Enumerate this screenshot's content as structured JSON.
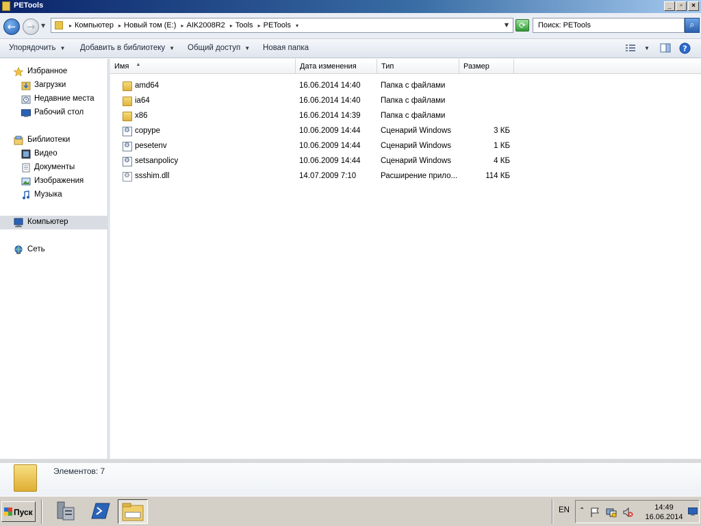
{
  "window": {
    "title": "PETools",
    "min_glyph": "_",
    "max_glyph": "▫",
    "close_glyph": "×"
  },
  "address": {
    "back_glyph": "←",
    "forward_glyph": "→",
    "breadcrumb": [
      "Компьютер",
      "Новый том (E:)",
      "AIK2008R2",
      "Tools",
      "PETools"
    ],
    "search_placeholder": "Поиск: PETools"
  },
  "toolbar": {
    "organize_label": "Упорядочить",
    "include_library_label": "Добавить в библиотеку",
    "share_label": "Общий доступ",
    "new_folder_label": "Новая папка"
  },
  "navigation": {
    "favorites": {
      "label": "Избранное",
      "icon": "star-icon"
    },
    "downloads": {
      "label": "Загрузки",
      "icon": "downloads-icon"
    },
    "recent": {
      "label": "Недавние места",
      "icon": "recent-places-icon"
    },
    "desktop": {
      "label": "Рабочий стол",
      "icon": "desktop-icon"
    },
    "libraries": {
      "label": "Библиотеки",
      "icon": "libraries-icon"
    },
    "video": {
      "label": "Видео",
      "icon": "video-icon"
    },
    "documents": {
      "label": "Документы",
      "icon": "documents-icon"
    },
    "pictures": {
      "label": "Изображения",
      "icon": "pictures-icon"
    },
    "music": {
      "label": "Музыка",
      "icon": "music-icon"
    },
    "computer": {
      "label": "Компьютер",
      "icon": "computer-icon",
      "selected": true
    },
    "network": {
      "label": "Сеть",
      "icon": "network-icon"
    }
  },
  "columns": {
    "name": "Имя",
    "date": "Дата изменения",
    "type": "Тип",
    "size": "Размер"
  },
  "files": [
    {
      "name": "amd64",
      "date": "16.06.2014 14:40",
      "type": "Папка с файлами",
      "size": "",
      "icon": "folder-icon"
    },
    {
      "name": "ia64",
      "date": "16.06.2014 14:40",
      "type": "Папка с файлами",
      "size": "",
      "icon": "folder-icon"
    },
    {
      "name": "x86",
      "date": "16.06.2014 14:39",
      "type": "Папка с файлами",
      "size": "",
      "icon": "folder-icon"
    },
    {
      "name": "copype",
      "date": "10.06.2009 14:44",
      "type": "Сценарий Windows",
      "size": "3 КБ",
      "icon": "script-icon"
    },
    {
      "name": "pesetenv",
      "date": "10.06.2009 14:44",
      "type": "Сценарий Windows",
      "size": "1 КБ",
      "icon": "script-icon"
    },
    {
      "name": "setsanpolicy",
      "date": "10.06.2009 14:44",
      "type": "Сценарий Windows",
      "size": "4 КБ",
      "icon": "script-icon"
    },
    {
      "name": "ssshim.dll",
      "date": "14.07.2009 7:10",
      "type": "Расширение прило...",
      "size": "114 КБ",
      "icon": "dll-icon"
    }
  ],
  "details": {
    "count_text": "Элементов: 7"
  },
  "taskbar": {
    "start_label": "Пуск",
    "language": "EN",
    "time": "14:49",
    "date": "16.06.2014"
  }
}
